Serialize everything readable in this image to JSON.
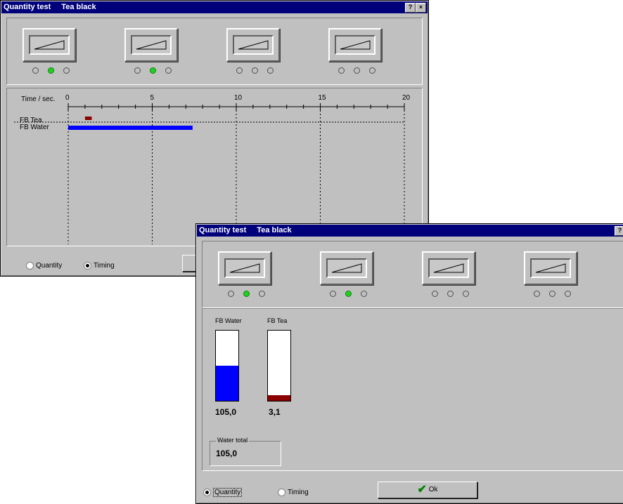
{
  "back_window": {
    "title": "Quantity test",
    "title_product": "Tea black",
    "help_icon_label": "?",
    "close_icon_label": "×",
    "gauges": [
      {
        "leds": [
          false,
          true,
          false
        ]
      },
      {
        "leds": [
          false,
          true,
          false
        ]
      },
      {
        "leds": [
          false,
          false,
          false
        ]
      },
      {
        "leds": [
          false,
          false,
          false
        ]
      }
    ],
    "timeline": {
      "axis_label": "Time / sec.",
      "ticks": [
        "0",
        "5",
        "10",
        "15",
        "20"
      ],
      "rows": [
        "FB Tea",
        "FB Water"
      ],
      "tea_bar": {
        "start": 1.0,
        "end": 1.4,
        "color": "#8b0000"
      },
      "water_bar": {
        "start": 0,
        "end": 7.4,
        "color": "#0000ff"
      }
    },
    "radios": {
      "quantity_label": "Quantity",
      "timing_label": "Timing",
      "selected": "timing"
    }
  },
  "front_window": {
    "title": "Quantity test",
    "title_product": "Tea black",
    "help_icon_label": "?",
    "gauges": [
      {
        "leds": [
          false,
          true,
          false
        ]
      },
      {
        "leds": [
          false,
          true,
          false
        ]
      },
      {
        "leds": [
          false,
          false,
          false
        ]
      },
      {
        "leds": [
          false,
          false,
          false
        ]
      }
    ],
    "bars": [
      {
        "label": "FB Water",
        "value": "105,0",
        "fill_fraction": 0.5,
        "color": "#0000ff"
      },
      {
        "label": "FB Tea",
        "value": "3,1",
        "fill_fraction": 0.08,
        "color": "#8b0000"
      }
    ],
    "water_total": {
      "caption": "Water total",
      "value": "105,0"
    },
    "radios": {
      "quantity_label": "Quantity",
      "timing_label": "Timing",
      "selected": "quantity"
    },
    "ok_button": {
      "label": "Ok",
      "icon": "checkmark-icon",
      "icon_color": "#008000"
    }
  }
}
